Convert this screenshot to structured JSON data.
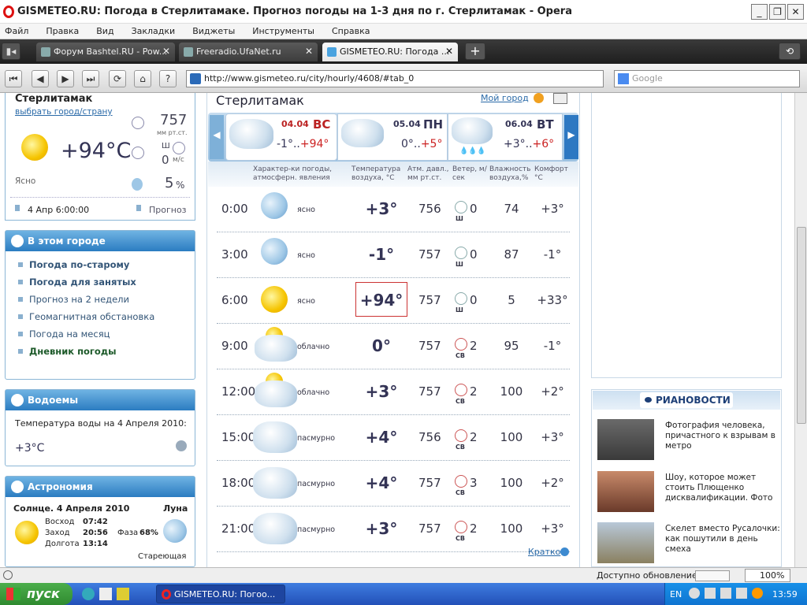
{
  "window": {
    "title": "GISMETEO.RU: Погода в Стерлитамаке. Прогноз погоды на 1-3 дня по г. Стерлитамак - Opera"
  },
  "menu": [
    "Файл",
    "Правка",
    "Вид",
    "Закладки",
    "Виджеты",
    "Инструменты",
    "Справка"
  ],
  "tabs": [
    {
      "label": "Форум Bashtel.RU - Pow..."
    },
    {
      "label": "Freeradio.UfaNet.ru"
    },
    {
      "label": "GISMETEO.RU: Погода ..."
    }
  ],
  "address": {
    "url": "http://www.gismeteo.ru/city/hourly/4608/#tab_0",
    "search_placeholder": "Google"
  },
  "left": {
    "city": "Стерлитамак",
    "choose_city": "выбрать город/страну",
    "pressure": "757",
    "pressure_unit": "мм рт.ст.",
    "temp": "+94°C",
    "wind_dir": "Ш",
    "wind_speed": "0",
    "wind_unit": "м/с",
    "condition": "Ясно",
    "humidity": "5",
    "humidity_unit": "%",
    "datetime": "4 Апр 6:00:00",
    "forecast_link": "Прогноз",
    "city_panel_title": "В этом городе",
    "city_links": [
      "Погода по-старому",
      "Погода для занятых",
      "Прогноз на 2 недели",
      "Геомагнитная обстановка",
      "Погода на месяц",
      "Дневник погоды"
    ],
    "water_title": "Водоемы",
    "water_text": "Температура воды на 4 Апреля 2010:",
    "water_temp": "+3°C",
    "astro_title": "Астрономия",
    "sun_title": "Солнце. 4 Апреля 2010",
    "moon_title": "Луна",
    "sunrise_label": "Восход",
    "sunrise": "07:42",
    "sunset_label": "Заход",
    "sunset": "20:56",
    "daylen_label": "Долгота",
    "daylen": "13:14",
    "phase_label": "Фаза",
    "phase": "68%",
    "moon_state": "Стареющая"
  },
  "main": {
    "city": "Стерлитамак",
    "my_city": "Мой город",
    "days": [
      {
        "date": "04.04",
        "dow": "ВС",
        "min": "-1°",
        "max": "+94°"
      },
      {
        "date": "05.04",
        "dow": "ПН",
        "min": "0°",
        "max": "+5°"
      },
      {
        "date": "06.04",
        "dow": "ВТ",
        "min": "+3°",
        "max": "+6°"
      }
    ],
    "headers": {
      "char": "Характер-ки погоды, атмосферн. явления",
      "temp": "Температура воздуха, °С",
      "press": "Атм. давл., мм рт.ст.",
      "wind": "Ветер, м/сек",
      "hum": "Влажность воздуха,%",
      "comfort": "Комфорт °С"
    },
    "rows": [
      {
        "time": "0:00",
        "icon": "moon-icon",
        "cond": "ясно",
        "temp": "+3°",
        "press": "756",
        "wdir": "Ш",
        "wspd": "0",
        "hum": "74",
        "comf": "+3°"
      },
      {
        "time": "3:00",
        "icon": "moon-icon",
        "cond": "ясно",
        "temp": "-1°",
        "press": "757",
        "wdir": "Ш",
        "wspd": "0",
        "hum": "87",
        "comf": "-1°"
      },
      {
        "time": "6:00",
        "icon": "sun-icon",
        "cond": "ясно",
        "temp": "+94°",
        "press": "757",
        "wdir": "Ш",
        "wspd": "0",
        "hum": "5",
        "comf": "+33°"
      },
      {
        "time": "9:00",
        "icon": "partly-cloudy-icon",
        "cond": "облачно",
        "temp": "0°",
        "press": "757",
        "wdir": "СВ",
        "wspd": "2",
        "hum": "95",
        "comf": "-1°"
      },
      {
        "time": "12:00",
        "icon": "partly-cloudy-icon",
        "cond": "облачно",
        "temp": "+3°",
        "press": "757",
        "wdir": "СВ",
        "wspd": "2",
        "hum": "100",
        "comf": "+2°"
      },
      {
        "time": "15:00",
        "icon": "cloud-icon",
        "cond": "пасмурно",
        "temp": "+4°",
        "press": "756",
        "wdir": "СВ",
        "wspd": "2",
        "hum": "100",
        "comf": "+3°"
      },
      {
        "time": "18:00",
        "icon": "cloud-icon",
        "cond": "пасмурно",
        "temp": "+4°",
        "press": "757",
        "wdir": "СВ",
        "wspd": "3",
        "hum": "100",
        "comf": "+2°"
      },
      {
        "time": "21:00",
        "icon": "cloud-icon",
        "cond": "пасмурно",
        "temp": "+3°",
        "press": "757",
        "wdir": "СВ",
        "wspd": "2",
        "hum": "100",
        "comf": "+3°"
      }
    ],
    "brief_link": "Кратко"
  },
  "right": {
    "news_logo": "РИАНОВОСТИ",
    "news": [
      {
        "text": "Фотография человека, причастного к взрывам в метро"
      },
      {
        "text": "Шоу, которое может стоить Плющенко дисквалификации. Фото"
      },
      {
        "text": "Скелет вместо Русалочки: как пошутили в день смеха"
      }
    ]
  },
  "status": {
    "update": "Доступно обновление",
    "zoom": "100%"
  },
  "taskbar": {
    "start": "пуск",
    "task": "GISMETEO.RU: Погоо...",
    "lang": "EN",
    "time": "13:59"
  }
}
